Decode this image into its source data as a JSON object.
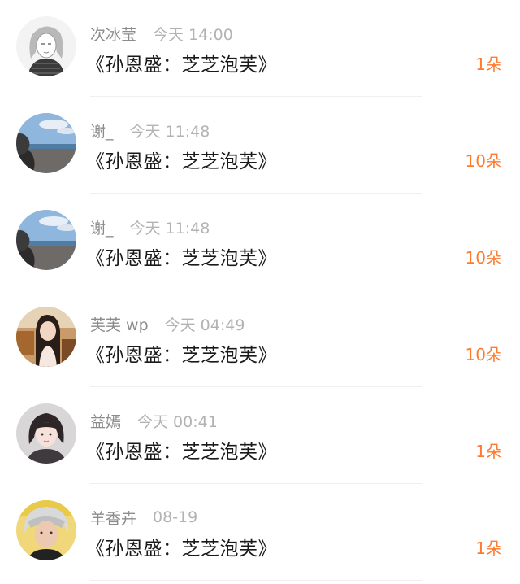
{
  "gift_list": {
    "items": [
      {
        "name": "次冰莹",
        "time": "今天 14:00",
        "title": "《孙恩盛：芝芝泡芙》",
        "count": "1朵",
        "avatar_icon": "sketch-girl-avatar-icon"
      },
      {
        "name": "谢_",
        "time": "今天 11:48",
        "title": "《孙恩盛：芝芝泡芙》",
        "count": "10朵",
        "avatar_icon": "beach-avatar-icon"
      },
      {
        "name": "谢_",
        "time": "今天 11:48",
        "title": "《孙恩盛：芝芝泡芙》",
        "count": "10朵",
        "avatar_icon": "beach-avatar-icon"
      },
      {
        "name": "芙芙 wp",
        "time": "今天 04:49",
        "title": "《孙恩盛：芝芝泡芙》",
        "count": "10朵",
        "avatar_icon": "girl-photo-avatar-icon"
      },
      {
        "name": "益嫣",
        "time": "今天 00:41",
        "title": "《孙恩盛：芝芝泡芙》",
        "count": "1朵",
        "avatar_icon": "girl-portrait-avatar-icon"
      },
      {
        "name": "羊香卉",
        "time": "08-19",
        "title": "《孙恩盛：芝芝泡芙》",
        "count": "1朵",
        "avatar_icon": "blond-boy-avatar-icon"
      }
    ]
  },
  "colors": {
    "count_accent": "#ff7a2e",
    "name_gray": "#8c8c8c",
    "time_gray": "#b3b3b3",
    "title_text": "#1a1a1a"
  }
}
